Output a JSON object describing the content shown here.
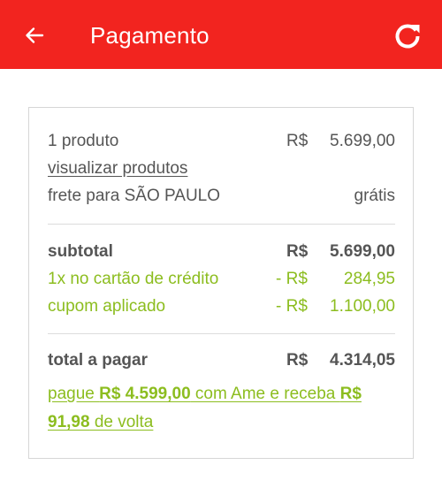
{
  "appbar": {
    "title": "Pagamento",
    "back_icon": "arrow-back-icon",
    "refresh_icon": "refresh-icon",
    "background": "#f2241f"
  },
  "summary": {
    "products": {
      "label": "1 produto",
      "currency": "R$",
      "value": "5.699,00"
    },
    "view_products_link": "visualizar produtos",
    "shipping": {
      "label": "frete para SÃO PAULO",
      "value": "grátis"
    },
    "subtotal": {
      "label": "subtotal",
      "currency": "R$",
      "value": "5.699,00"
    },
    "credit_card_discount": {
      "label": "1x no cartão de crédito",
      "currency": "- R$",
      "value": "284,95"
    },
    "coupon": {
      "label": "cupom aplicado",
      "currency": "- R$",
      "value": "1.100,00"
    },
    "total": {
      "label": "total a pagar",
      "currency": "R$",
      "value": "4.314,05"
    }
  },
  "ame_offer": {
    "prefix": "pague ",
    "amount": "R$ 4.599,00",
    "middle": " com Ame e receba ",
    "cashback": "R$ 91,98",
    "suffix": " de volta"
  },
  "colors": {
    "text": "#555555",
    "accent_green": "#8cbd1f",
    "border": "#d6d6d6"
  }
}
